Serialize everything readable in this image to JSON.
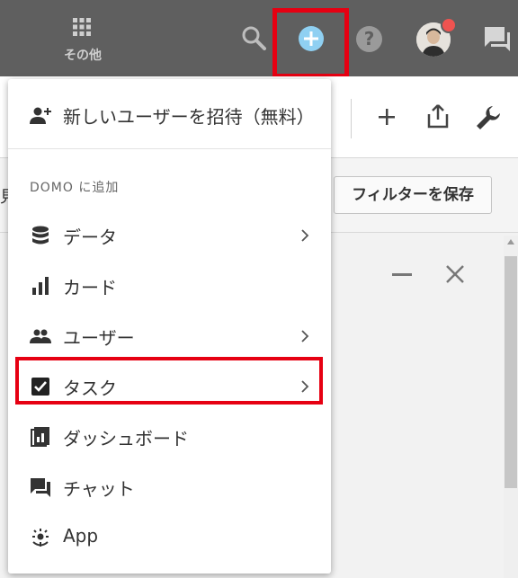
{
  "topbar": {
    "more_label": "その他",
    "icons": [
      "grid-icon",
      "search-icon",
      "add-circle-icon",
      "help-icon",
      "avatar",
      "chat-icon"
    ],
    "help_glyph": "?",
    "colors": {
      "bar": "#5f5f5f",
      "plus": "#8fd0f2",
      "highlight": "#e60012",
      "notification": "#ef5350"
    }
  },
  "page": {
    "save_filter_label": "フィルターを保存",
    "left_partial_text": "見"
  },
  "menu": {
    "invite": {
      "label": "新しいユーザーを招待（無料）",
      "icon": "person-add-icon"
    },
    "section_title": "DOMO に追加",
    "items": [
      {
        "label": "データ",
        "icon": "database-icon",
        "has_submenu": true
      },
      {
        "label": "カード",
        "icon": "bar-chart-icon",
        "has_submenu": false
      },
      {
        "label": "ユーザー",
        "icon": "people-icon",
        "has_submenu": true
      },
      {
        "label": "タスク",
        "icon": "checkbox-icon",
        "has_submenu": true,
        "highlighted": true
      },
      {
        "label": "ダッシュボード",
        "icon": "dashboard-icon",
        "has_submenu": false
      },
      {
        "label": "チャット",
        "icon": "chat-icon",
        "has_submenu": false
      },
      {
        "label": "App",
        "icon": "app-icon",
        "has_submenu": false
      }
    ]
  }
}
